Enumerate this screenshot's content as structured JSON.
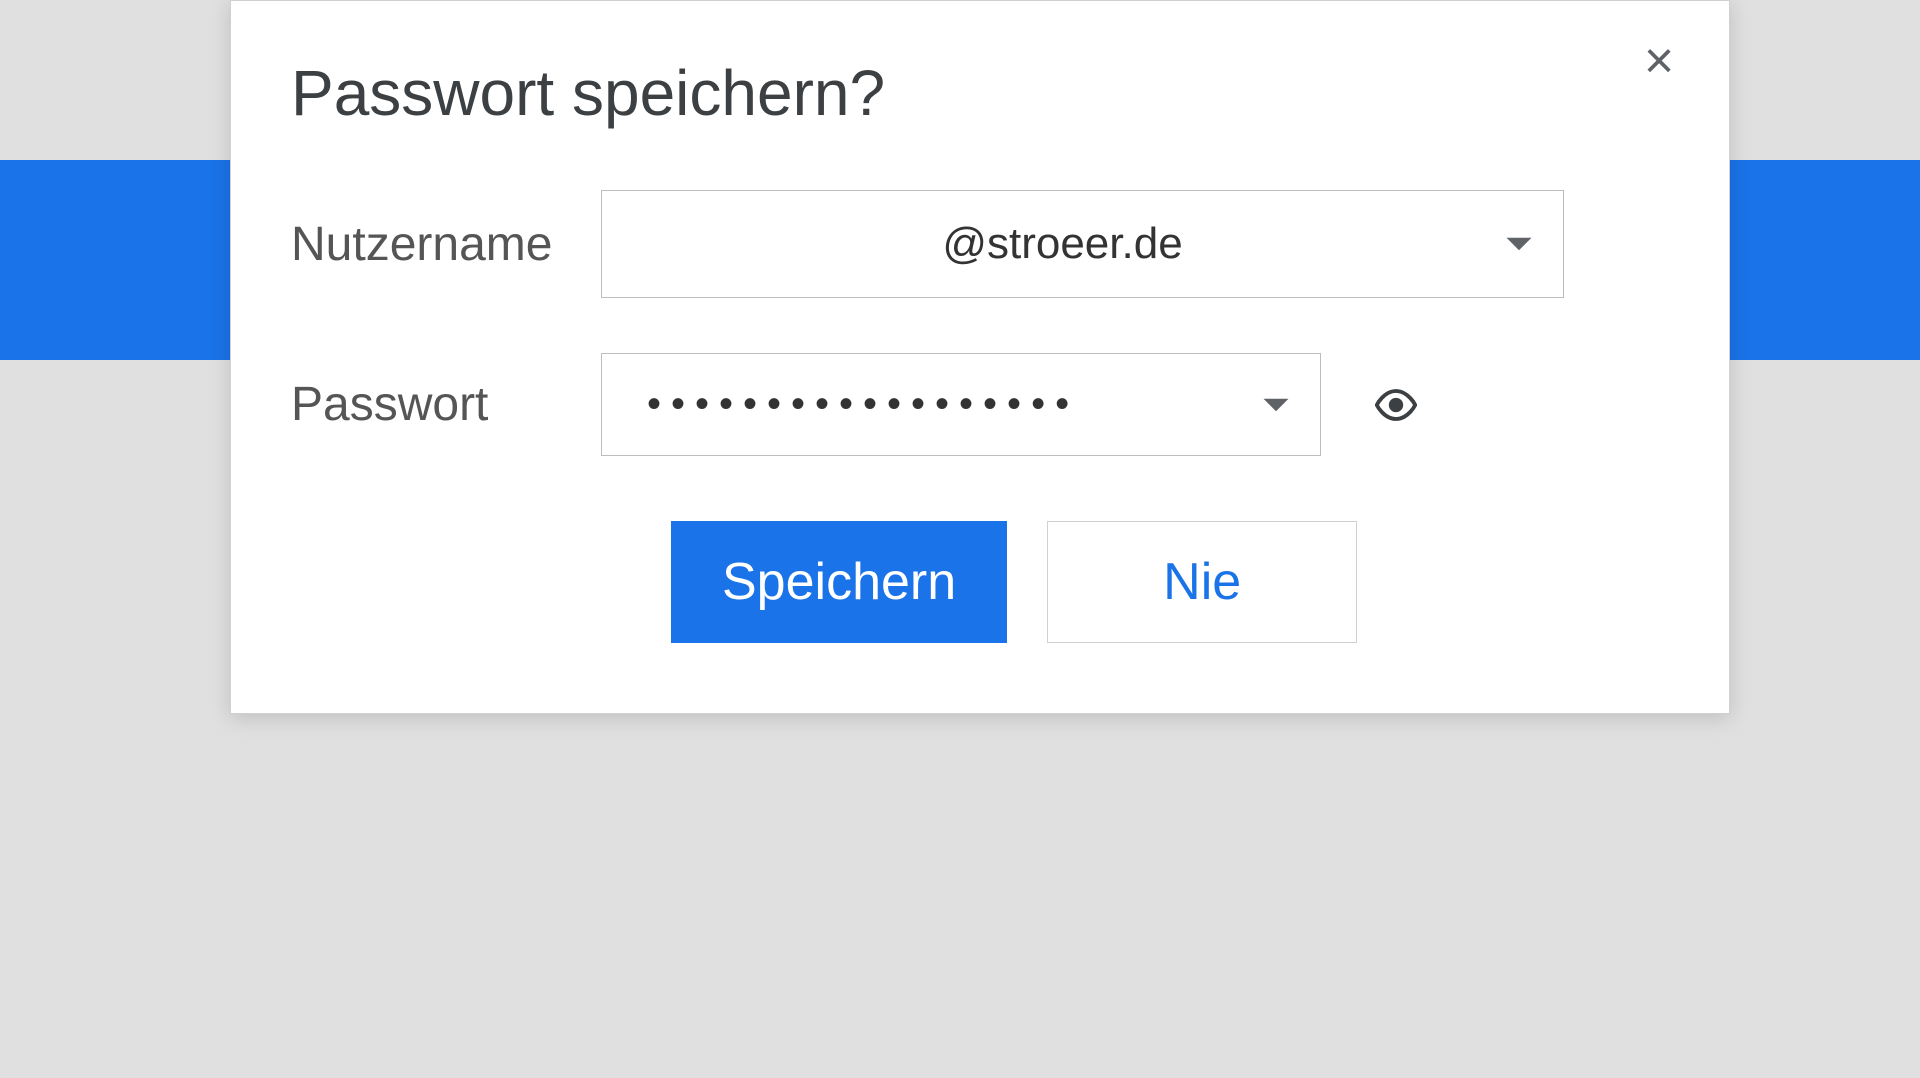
{
  "dialog": {
    "title": "Passwort speichern?",
    "close_icon": "×",
    "username_label": "Nutzername",
    "username_value": "@stroeer.de",
    "password_label": "Passwort",
    "password_value": "••••••••••••••••••",
    "save_button": "Speichern",
    "never_button": "Nie"
  },
  "colors": {
    "primary": "#1a73e8",
    "text": "#3c4043",
    "border": "#bdbdbd"
  }
}
